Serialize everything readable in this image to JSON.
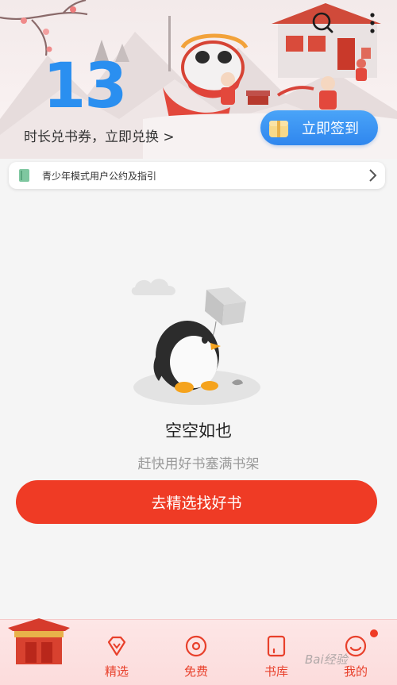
{
  "banner": {
    "checkin_days": "13",
    "exchange_text": "时长兑书券，立即兑换 >",
    "signin_label": "立即签到"
  },
  "toolbar": {
    "search_icon": "search-icon",
    "more_icon": "more-vertical-icon"
  },
  "notice": {
    "label": "青少年模式用户公约及指引",
    "icon": "book-icon"
  },
  "empty_state": {
    "title": "空空如也",
    "subtitle": "赶快用好书塞满书架",
    "button_label": "去精选找好书"
  },
  "bottom_nav": {
    "items": [
      {
        "label": "精选",
        "icon": "diamond-icon"
      },
      {
        "label": "免费",
        "icon": "coin-icon"
      },
      {
        "label": "书库",
        "icon": "library-icon"
      },
      {
        "label": "我的",
        "icon": "smile-icon"
      }
    ]
  },
  "watermark": "Bai经验",
  "colors": {
    "accent_blue": "#2a8ff0",
    "accent_red": "#ef3b25"
  }
}
